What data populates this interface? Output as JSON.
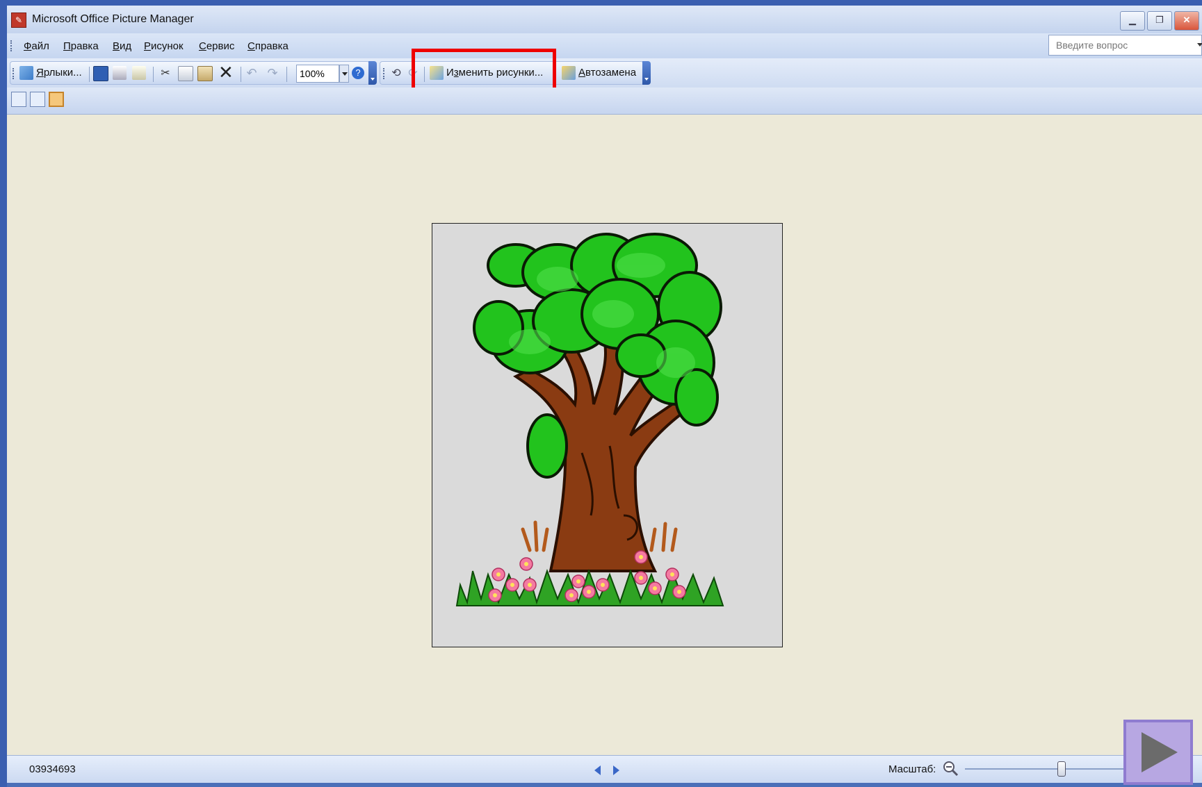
{
  "window": {
    "title": "Microsoft Office Picture Manager",
    "app_icon": "picture-manager-icon",
    "controls": [
      "minimize-icon",
      "restore-icon",
      "close-icon"
    ]
  },
  "menubar": {
    "items": [
      {
        "underline": "Ф",
        "rest": "айл"
      },
      {
        "underline": "П",
        "rest": "равка"
      },
      {
        "underline": "В",
        "rest": "ид"
      },
      {
        "underline": "Р",
        "rest": "исунок"
      },
      {
        "underline": "С",
        "rest": "ервис"
      },
      {
        "underline": "С",
        "rest": "правка"
      }
    ],
    "ask_placeholder": "Введите вопрос"
  },
  "toolbar": {
    "shortcuts_label_u": "Я",
    "shortcuts_label_rest": "рлыки...",
    "zoom_value": "100%",
    "edit_pictures_pre": "И",
    "edit_pictures_u": "з",
    "edit_pictures_rest": "менить рисунки...",
    "autocorrect_u": "А",
    "autocorrect_rest": "втозамена",
    "icons": [
      "shortcuts-icon",
      "save-icon",
      "print-icon",
      "email-icon",
      "cut-icon",
      "copy-icon",
      "paste-icon",
      "delete-icon",
      "undo-icon",
      "redo-icon",
      "help-icon",
      "rotate-left-icon",
      "rotate-right-icon",
      "edit-pictures-icon",
      "autocorrect-icon"
    ]
  },
  "viewbar": {
    "views": [
      "thumbnail-view-icon",
      "filmstrip-view-icon",
      "single-picture-view-icon"
    ],
    "active_view": "single-picture-view-icon"
  },
  "picture": {
    "subject": "tree-illustration"
  },
  "statusbar": {
    "file_name": "03934693",
    "zoom_label": "Масштаб:",
    "zoom_fraction": 0.58
  },
  "overlay": {
    "next_slide_icon": "play-next-icon"
  },
  "colors": {
    "highlight": "#ee0000",
    "canvas": "#ece9d8",
    "frame": "#3b5fb0"
  }
}
